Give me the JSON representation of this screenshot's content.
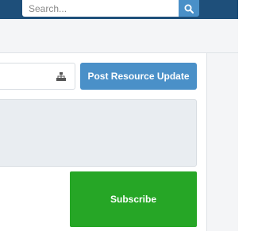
{
  "header": {
    "search": {
      "placeholder": "Search...",
      "value": ""
    },
    "search_icon": "search-icon"
  },
  "resource": {
    "post_update_label": "Post Resource Update",
    "tree_icon": "sitemap-icon",
    "subscribe_label": "Subscribe"
  },
  "colors": {
    "header_bg": "#1e4f7a",
    "accent_blue": "#4a90c8",
    "subscribe_green": "#26a626",
    "panel_bg": "#e9edf1"
  }
}
